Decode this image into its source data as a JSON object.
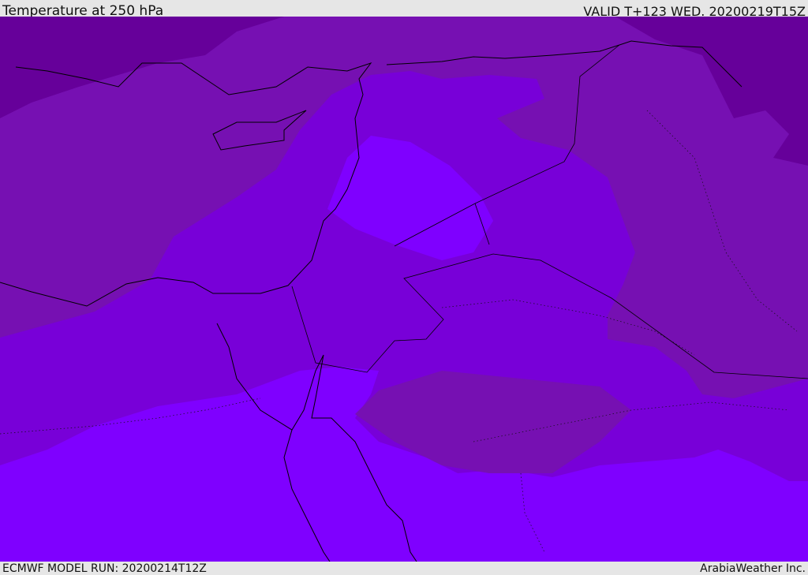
{
  "header": {
    "title": "Temperature at 250 hPa",
    "valid": "VALID T+123 WED. 20200219T15Z"
  },
  "footer": {
    "model_run": "ECMWF MODEL RUN: 20200214T12Z",
    "credit": "ArabiaWeather Inc."
  },
  "colors": {
    "band_coldest": "#66009a",
    "band_cold": "#7610b2",
    "band_mid": "#7800d8",
    "band_warm": "#7f00ff",
    "coast": "#000000"
  }
}
